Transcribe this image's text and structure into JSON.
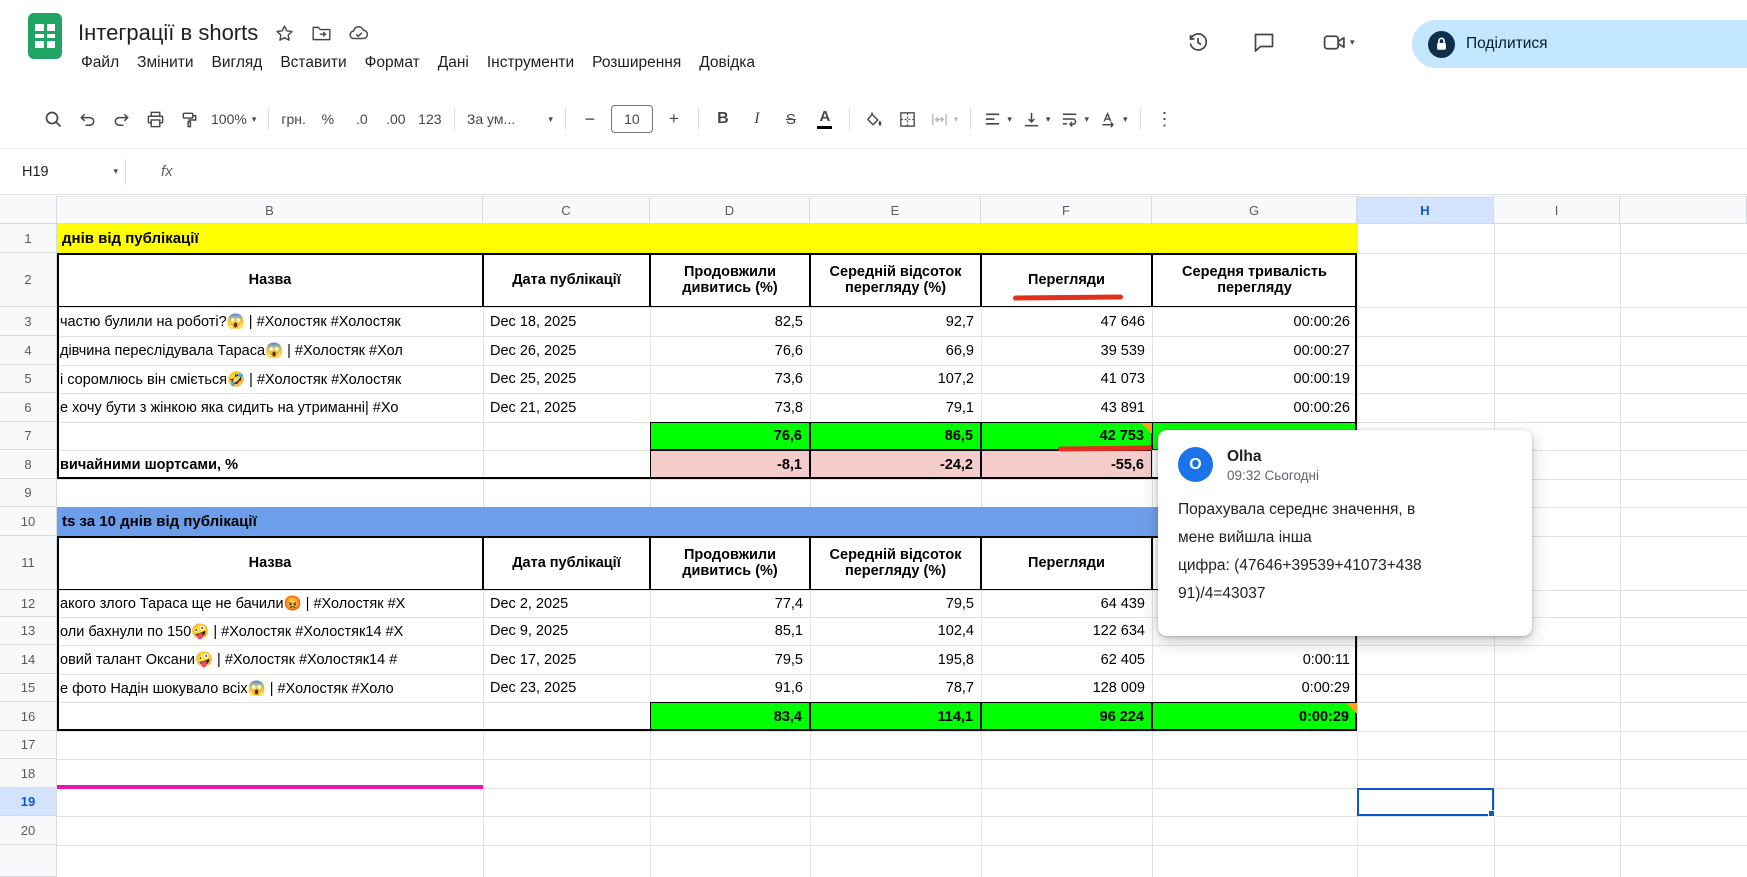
{
  "titlebar": {
    "doc_title": "Інтеграції в shorts",
    "menus": [
      "Файл",
      "Змінити",
      "Вигляд",
      "Вставити",
      "Формат",
      "Дані",
      "Інструменти",
      "Розширення",
      "Довідка"
    ],
    "share_label": "Поділитися"
  },
  "toolbar": {
    "zoom": "100%",
    "currency": "грн.",
    "percent": "%",
    "dec_decrease": ".0",
    "dec_increase": ".00",
    "more_formats": "123",
    "font_name": "За ум...",
    "minus": "−",
    "font_size": "10",
    "plus": "+",
    "bold": "B",
    "italic": "I",
    "strike": "S",
    "text_color": "A",
    "more": "⋮"
  },
  "formula_bar": {
    "name_box": "H19",
    "fx": "fx"
  },
  "grid": {
    "cols": [
      "B",
      "C",
      "D",
      "E",
      "F",
      "G",
      "H",
      "I"
    ],
    "rows": [
      "1",
      "2",
      "3",
      "4",
      "5",
      "6",
      "7",
      "8",
      "9",
      "10",
      "11",
      "12",
      "13",
      "14",
      "15",
      "16",
      "17",
      "18",
      "19",
      "20"
    ]
  },
  "sheet": {
    "banner1": "днів від публікації",
    "banner2": "ts за 10 днів від публікації",
    "h": {
      "name": "Назва",
      "date": "Дата публікації",
      "cont": "Продовжили дивитись (%)",
      "avg": "Середній відсоток перегляду (%)",
      "views": "Перегляди",
      "dur": "Середня тривалість перегляду"
    },
    "t1": {
      "rows": [
        {
          "name": "частю булили на роботі?😱 | #Холостяк #Холостяк",
          "date": "Dec 18, 2025",
          "cont": "82,5",
          "avg": "92,7",
          "views": "47 646",
          "dur": "00:00:26"
        },
        {
          "name": "дівчина переслідувала Тараса😱 | #Холостяк #Хол",
          "date": "Dec 26, 2025",
          "cont": "76,6",
          "avg": "66,9",
          "views": "39 539",
          "dur": "00:00:27"
        },
        {
          "name": "і соромлюсь він сміється🤣 | #Холостяк #Холостяк",
          "date": "Dec 25, 2025",
          "cont": "73,6",
          "avg": "107,2",
          "views": "41 073",
          "dur": "00:00:19"
        },
        {
          "name": "е хочу бути з жінкою яка сидить на утриманні| #Хо",
          "date": "Dec 21, 2025",
          "cont": "73,8",
          "avg": "79,1",
          "views": "43 891",
          "dur": "00:00:26"
        }
      ],
      "avg_row": {
        "cont": "76,6",
        "avg": "86,5",
        "views": "42 753"
      },
      "compare_label": "вичайними шортсами, %",
      "compare_row": {
        "cont": "-8,1",
        "avg": "-24,2",
        "views": "-55,6"
      }
    },
    "t2": {
      "rows": [
        {
          "name": "акого злого Тараса ще не бачили😡 | #Холостяк #Х",
          "date": "Dec 2, 2025",
          "cont": "77,4",
          "avg": "79,5",
          "views": "64 439"
        },
        {
          "name": "оли бахнули по 150🤪 | #Холостяк #Холостяк14 #Х",
          "date": "Dec 9, 2025",
          "cont": "85,1",
          "avg": "102,4",
          "views": "122 634"
        },
        {
          "name": "овий талант Оксани🤪 | #Холостяк #Холостяк14 #",
          "date": "Dec 17, 2025",
          "cont": "79,5",
          "avg": "195,8",
          "views": "62 405",
          "dur": "0:00:11"
        },
        {
          "name": "е фото Надін шокувало всіх😱 | #Холостяк #Холо",
          "date": "Dec 23, 2025",
          "cont": "91,6",
          "avg": "78,7",
          "views": "128 009",
          "dur": "0:00:29"
        }
      ],
      "avg_row": {
        "cont": "83,4",
        "avg": "114,1",
        "views": "96 224",
        "dur": "0:00:29"
      }
    }
  },
  "comment": {
    "initial": "O",
    "author": "Olha",
    "time": "09:32 Сьогодні",
    "lines": [
      "Порахувала середнє значення, в",
      "мене вийшла інша",
      "цифра: (47646+39539+41073+438",
      "91)/4=43037"
    ]
  }
}
